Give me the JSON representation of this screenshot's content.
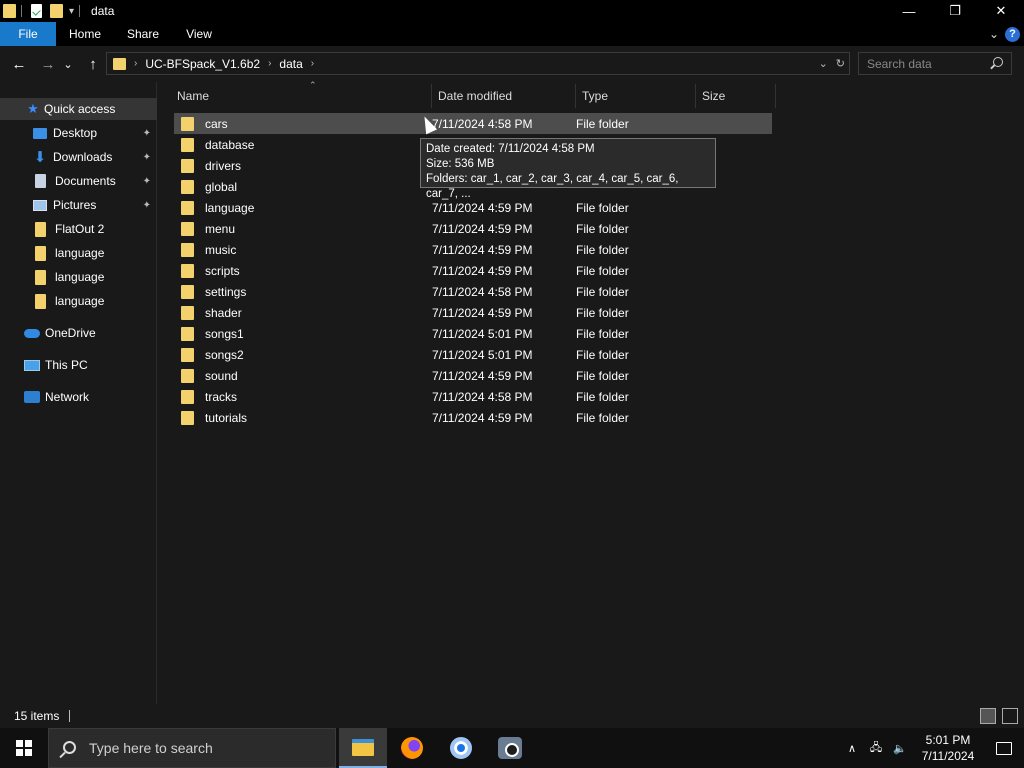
{
  "window": {
    "title": "data",
    "minimize": "—",
    "maximize": "❐",
    "close": "✕"
  },
  "ribbon": {
    "tabs": [
      "File",
      "Home",
      "Share",
      "View"
    ],
    "collapse": "⌄",
    "help": "?"
  },
  "address": {
    "crumbs": [
      "UC-BFSpack_V1.6b2",
      "data"
    ],
    "crumb_sep": "›",
    "dropdown": "⌄",
    "refresh": "↻"
  },
  "search": {
    "placeholder": "Search data"
  },
  "nav": {
    "back": "←",
    "forward": "→",
    "recent": "⌄",
    "up": "↑"
  },
  "sidebar": {
    "quick_access": "Quick access",
    "items": [
      {
        "label": "Desktop",
        "icon": "desktop-icon",
        "pinned": true
      },
      {
        "label": "Downloads",
        "icon": "download-icon",
        "pinned": true
      },
      {
        "label": "Documents",
        "icon": "documents-icon",
        "pinned": true
      },
      {
        "label": "Pictures",
        "icon": "pictures-icon",
        "pinned": true
      },
      {
        "label": "FlatOut 2",
        "icon": "folder-icon",
        "pinned": false
      },
      {
        "label": "language",
        "icon": "folder-icon",
        "pinned": false
      },
      {
        "label": "language",
        "icon": "folder-icon",
        "pinned": false
      },
      {
        "label": "language",
        "icon": "folder-icon",
        "pinned": false
      }
    ],
    "onedrive": "OneDrive",
    "this_pc": "This PC",
    "network": "Network",
    "pin_glyph": "✦"
  },
  "columns": {
    "name": "Name",
    "date": "Date modified",
    "type": "Type",
    "size": "Size",
    "sort_caret": "⌃"
  },
  "files": [
    {
      "name": "cars",
      "date": "7/11/2024 4:58 PM",
      "type": "File folder"
    },
    {
      "name": "database",
      "date": "",
      "type": ""
    },
    {
      "name": "drivers",
      "date": "",
      "type": ""
    },
    {
      "name": "global",
      "date": "",
      "type": ""
    },
    {
      "name": "language",
      "date": "7/11/2024 4:59 PM",
      "type": "File folder"
    },
    {
      "name": "menu",
      "date": "7/11/2024 4:59 PM",
      "type": "File folder"
    },
    {
      "name": "music",
      "date": "7/11/2024 4:59 PM",
      "type": "File folder"
    },
    {
      "name": "scripts",
      "date": "7/11/2024 4:59 PM",
      "type": "File folder"
    },
    {
      "name": "settings",
      "date": "7/11/2024 4:58 PM",
      "type": "File folder"
    },
    {
      "name": "shader",
      "date": "7/11/2024 4:59 PM",
      "type": "File folder"
    },
    {
      "name": "songs1",
      "date": "7/11/2024 5:01 PM",
      "type": "File folder"
    },
    {
      "name": "songs2",
      "date": "7/11/2024 5:01 PM",
      "type": "File folder"
    },
    {
      "name": "sound",
      "date": "7/11/2024 4:59 PM",
      "type": "File folder"
    },
    {
      "name": "tracks",
      "date": "7/11/2024 4:58 PM",
      "type": "File folder"
    },
    {
      "name": "tutorials",
      "date": "7/11/2024 4:59 PM",
      "type": "File folder"
    }
  ],
  "tooltip": {
    "line1": "Date created: 7/11/2024 4:58 PM",
    "line2": "Size: 536 MB",
    "line3": "Folders: car_1, car_2, car_3, car_4, car_5, car_6, car_7, ..."
  },
  "status": {
    "count": "15 items"
  },
  "taskbar": {
    "search_placeholder": "Type here to search",
    "tray_up": "∧",
    "tray_net": "🖧",
    "tray_vol": "🔈",
    "time": "5:01 PM",
    "date": "7/11/2024"
  },
  "colors": {
    "accent": "#1979ca",
    "folder": "#f3d26d",
    "background": "#191919"
  }
}
